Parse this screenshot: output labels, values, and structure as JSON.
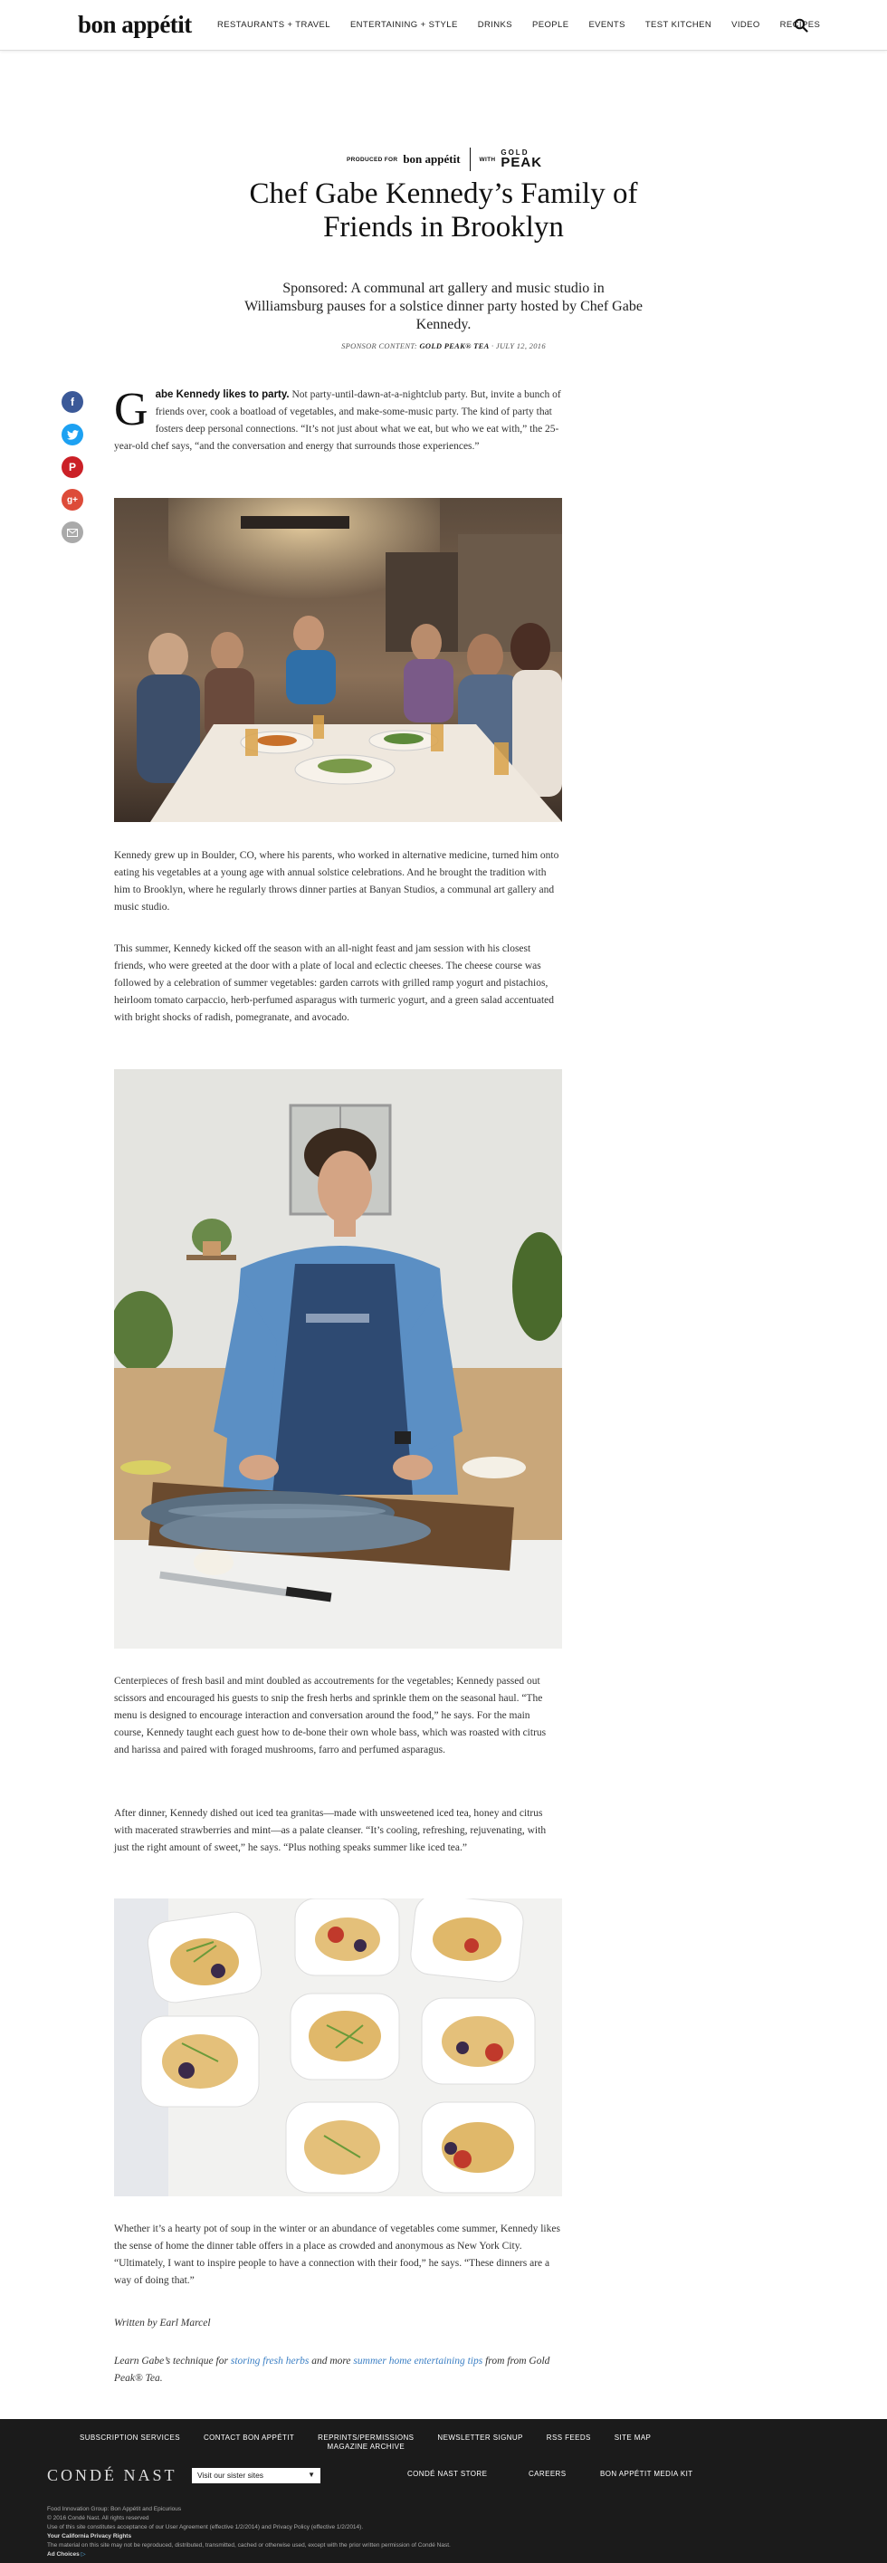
{
  "header": {
    "logo": "bon appétit",
    "nav": [
      "RESTAURANTS + TRAVEL",
      "ENTERTAINING + STYLE",
      "DRINKS",
      "PEOPLE",
      "EVENTS",
      "TEST KITCHEN",
      "VIDEO",
      "RECIPES"
    ],
    "search_icon": "search-icon"
  },
  "sponsor": {
    "produced_for": "PRODUCED FOR",
    "brand": "bon appétit",
    "with": "WITH",
    "partner_line1": "GOLD",
    "partner_line2": "PEAK"
  },
  "article": {
    "title": "Chef Gabe Kennedy’s Family of Friends in Brooklyn",
    "dek": "Sponsored: A communal art gallery and music studio in Williamsburg pauses for a solstice dinner party hosted by Chef Gabe Kennedy.",
    "byline_prefix": "SPONSOR CONTENT:",
    "byline_sponsor": "GOLD PEAK® TEA",
    "byline_date": "· JULY 12, 2016",
    "dropcap": "G",
    "lead": "abe Kennedy likes to party.",
    "p1": " Not party-until-dawn-at-a-nightclub party. But, invite a bunch of friends over, cook a boatload of vegetables, and make-some-music party. The kind of party that fosters deep personal connections. “It’s not just about what we eat, but who we eat with,” the 25-year-old chef says, “and the conversation and energy that surrounds those experiences.”",
    "p2": "Kennedy grew up in Boulder, CO, where his parents, who worked in alternative medicine, turned him onto eating his vegetables at a young age with annual solstice celebrations. And he brought the tradition with him to Brooklyn, where he regularly throws dinner parties at Banyan Studios, a communal art gallery and music studio.",
    "p3": "This summer, Kennedy kicked off the season with an all-night feast and jam session with his closest friends, who were greeted at the door with a plate of local and eclectic cheeses. The cheese course was followed by a celebration of summer vegetables: garden carrots with grilled ramp yogurt and pistachios, heirloom tomato carpaccio, herb-perfumed asparagus with turmeric yogurt, and a green salad accentuated with bright shocks of radish, pomegranate, and avocado.",
    "p4": "Centerpieces of fresh basil and mint doubled as accoutrements for the vegetables; Kennedy passed out scissors and encouraged his guests to snip the fresh herbs and sprinkle them on the seasonal haul. “The menu is designed to encourage interaction and conversation around the food,” he says. For the main course, Kennedy taught each guest how to de-bone their own whole bass, which was roasted with citrus and harissa and paired with foraged mushrooms, farro and perfumed asparagus.",
    "p5": "After dinner, Kennedy dished out iced tea granitas—made with unsweetened iced tea, honey and citrus with macerated strawberries and mint—as a palate cleanser. “It’s cooling, refreshing, rejuvenating, with just the right amount of sweet,” he says. “Plus nothing speaks summer like iced tea.”",
    "p6": "Whether it’s a hearty pot of soup in the winter or an abundance of vegetables come summer, Kennedy likes the sense of home the dinner table offers in a place as crowded and anonymous as New York City. “Ultimately, I want to inspire people to have a connection with their food,” he says. “These dinners are a way of doing that.”",
    "written_by": "Written by Earl Marcel",
    "learn_pre": "Learn Gabe’s technique for ",
    "learn_link1": "storing fresh herbs",
    "learn_mid": " and more ",
    "learn_link2": "summer home entertaining tips",
    "learn_post": " from from Gold Peak® Tea."
  },
  "share": [
    "facebook-icon",
    "twitter-icon",
    "pinterest-icon",
    "google-plus-icon",
    "email-icon"
  ],
  "footer": {
    "links": [
      "SUBSCRIPTION SERVICES",
      "CONTACT BON APPÉTIT",
      "REPRINTS/PERMISSIONS",
      "NEWSLETTER SIGNUP",
      "RSS FEEDS",
      "SITE MAP"
    ],
    "archive": "MAGAZINE ARCHIVE",
    "brand": "CONDÉ NAST",
    "sister_select": "Visit our sister sites",
    "mid_links": [
      "CONDÉ NAST STORE",
      "CAREERS",
      "BON APPÉTIT MEDIA KIT"
    ],
    "legal": [
      "Food Innovation Group: Bon Appétit and Epicurious",
      "© 2016 Condé Nast. All rights reserved",
      "Use of this site constitutes acceptance of our User Agreement (effective 1/2/2014) and Privacy Policy (effective 1/2/2014).",
      "Your California Privacy Rights",
      "The material on this site may not be reproduced, distributed, transmitted, cached or otherwise used, except with the prior written permission of Condé Nast.",
      "Ad Choices"
    ]
  },
  "colors": {
    "facebook": "#3b5998",
    "twitter": "#1da1f2",
    "pinterest": "#cb2027",
    "google": "#dd4b39",
    "email": "#aaaaaa",
    "link": "#3b7fc4",
    "footer_bg": "#1b1b1b"
  }
}
